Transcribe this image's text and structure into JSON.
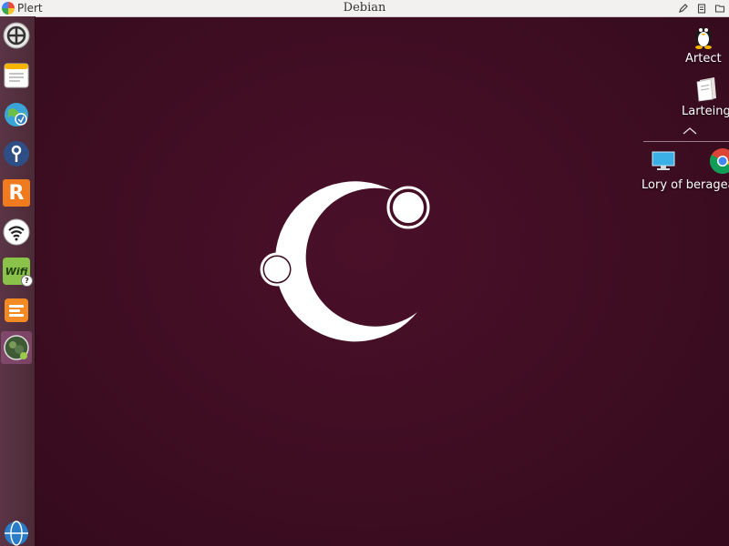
{
  "topbar": {
    "app_name": "Plert",
    "window_title": "Debian",
    "tray_icons": [
      "pencil-icon",
      "clipboard-icon",
      "folder-icon"
    ]
  },
  "launcher": {
    "items": [
      {
        "icon": "settings-hub-icon",
        "active": false
      },
      {
        "icon": "text-editor-icon",
        "active": false
      },
      {
        "icon": "network-globe-icon",
        "active": false
      },
      {
        "icon": "key-tool-icon",
        "active": false
      },
      {
        "icon": "r-app-icon",
        "label": "R",
        "active": false
      },
      {
        "icon": "wifi-app-icon",
        "active": false
      },
      {
        "icon": "wifi-settings-icon",
        "label": "Wifi",
        "active": false
      },
      {
        "icon": "orange-list-icon",
        "active": false
      },
      {
        "icon": "gallery-icon",
        "active": true
      },
      {
        "icon": "browser-globe-icon",
        "active": false
      }
    ]
  },
  "desktop": {
    "icons": [
      {
        "label": "Artect",
        "icon": "linux-tux-icon"
      },
      {
        "label": "Larteing",
        "icon": "document-stack-icon"
      },
      {
        "label": "Lory of beragea",
        "icon": "monitor-icon"
      },
      {
        "label": "",
        "icon": "chrome-icon"
      }
    ]
  },
  "colors": {
    "wallpaper": "#3e0d22",
    "topbar": "#f2f1f0",
    "launcher": "#5a3545"
  }
}
